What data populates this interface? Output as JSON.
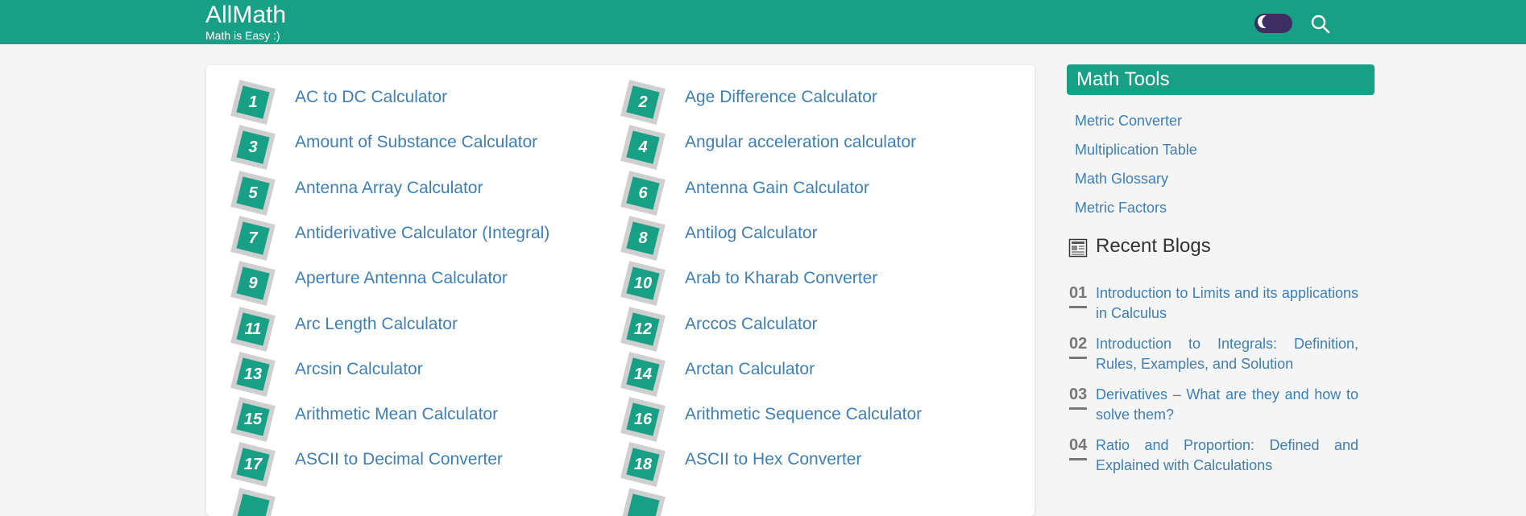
{
  "header": {
    "brand_title": "AllMath",
    "brand_tagline": "Math is Easy :)",
    "background_color": "#17a085",
    "theme_toggle_icon": "moon-icon",
    "search_icon": "search-icon"
  },
  "calculators": [
    {
      "num": "1",
      "label": "AC to DC Calculator"
    },
    {
      "num": "2",
      "label": "Age Difference Calculator"
    },
    {
      "num": "3",
      "label": "Amount of Substance Calculator"
    },
    {
      "num": "4",
      "label": "Angular acceleration calculator"
    },
    {
      "num": "5",
      "label": "Antenna Array Calculator"
    },
    {
      "num": "6",
      "label": "Antenna Gain Calculator"
    },
    {
      "num": "7",
      "label": "Antiderivative Calculator (Integral)"
    },
    {
      "num": "8",
      "label": "Antilog Calculator"
    },
    {
      "num": "9",
      "label": "Aperture Antenna Calculator"
    },
    {
      "num": "10",
      "label": "Arab to Kharab Converter"
    },
    {
      "num": "11",
      "label": "Arc Length Calculator"
    },
    {
      "num": "12",
      "label": "Arccos Calculator"
    },
    {
      "num": "13",
      "label": "Arcsin Calculator"
    },
    {
      "num": "14",
      "label": "Arctan Calculator"
    },
    {
      "num": "15",
      "label": "Arithmetic Mean Calculator"
    },
    {
      "num": "16",
      "label": "Arithmetic Sequence Calculator"
    },
    {
      "num": "17",
      "label": "ASCII to Decimal Converter"
    },
    {
      "num": "18",
      "label": "ASCII to Hex Converter"
    }
  ],
  "sidebar": {
    "tools_title": "Math Tools",
    "tools": [
      "Metric Converter",
      "Multiplication Table",
      "Math Glossary",
      "Metric Factors"
    ],
    "blogs_title": "Recent Blogs",
    "blogs": [
      {
        "num": "01",
        "title": "Introduction to Limits and its applications in Calculus"
      },
      {
        "num": "02",
        "title": "Introduction to Integrals: Definition, Rules, Examples, and Solution"
      },
      {
        "num": "03",
        "title": "Derivatives – What are they and how to solve them?"
      },
      {
        "num": "04",
        "title": "Ratio and Proportion: Defined and Explained with Calculations"
      }
    ]
  },
  "colors": {
    "accent": "#17a085",
    "link": "#3e7fb6",
    "toggle_bg": "#3c2e63"
  }
}
